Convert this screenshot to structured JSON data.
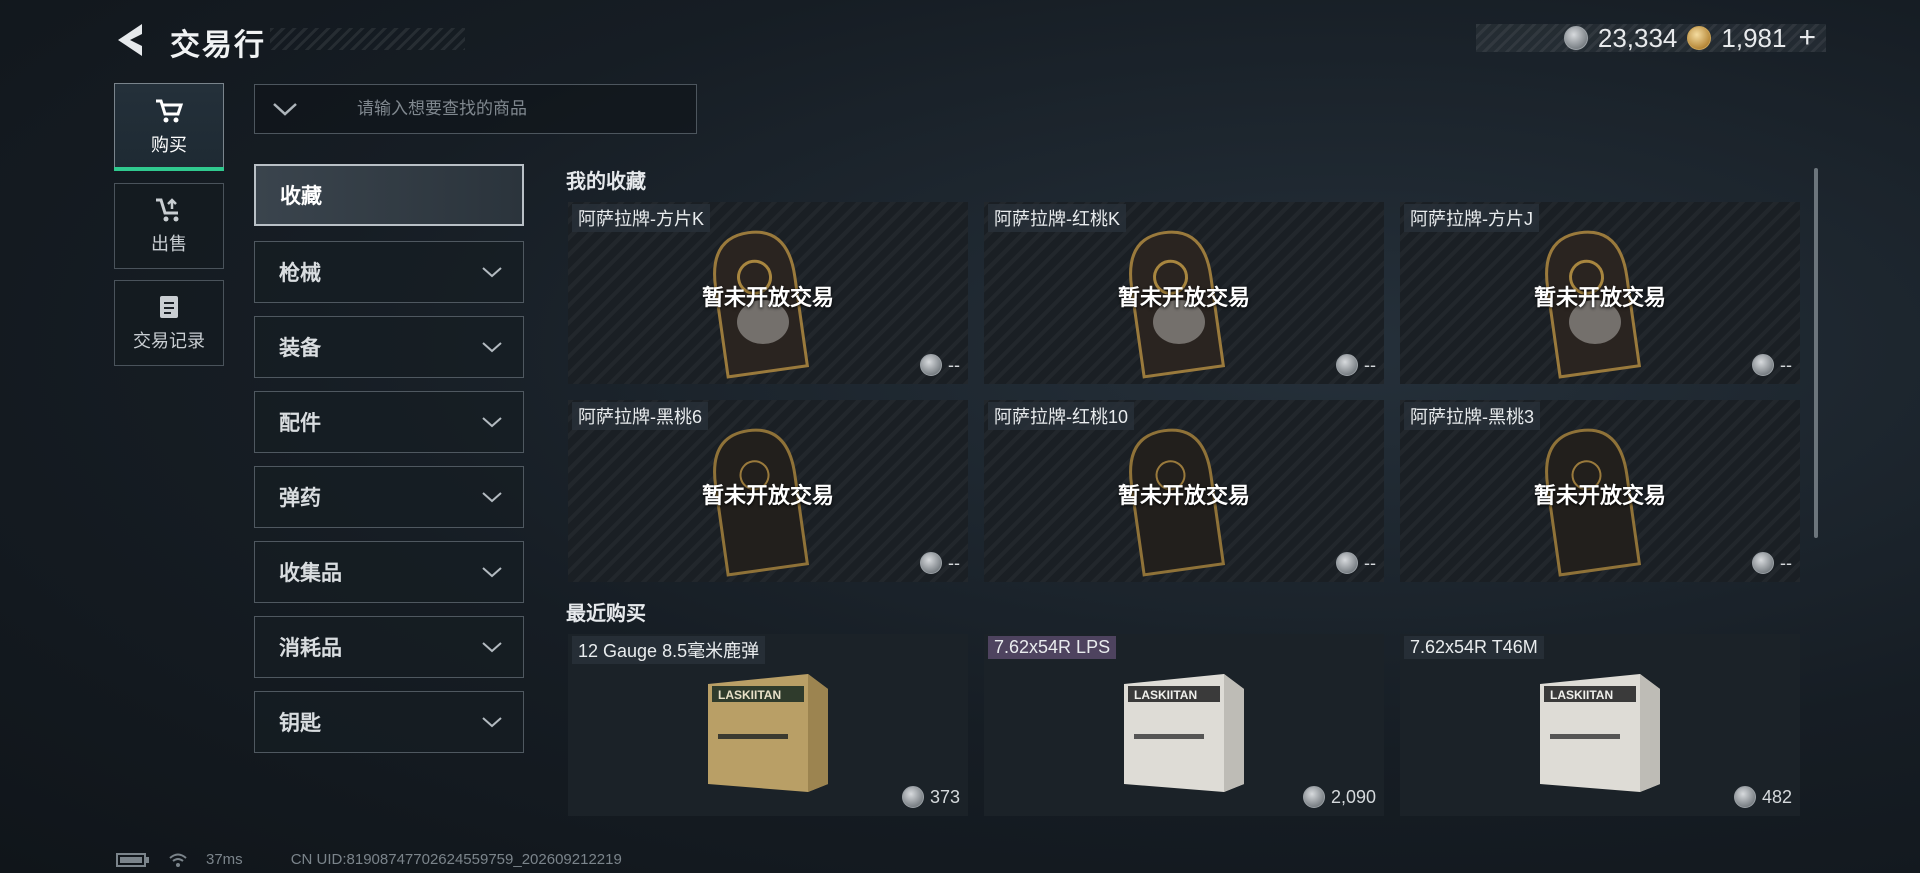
{
  "header": {
    "title": "交易行",
    "silver_amount": "23,334",
    "gold_amount": "1,981",
    "plus_label": "+"
  },
  "nav": [
    {
      "label": "购买",
      "icon": "cart-icon",
      "active": true
    },
    {
      "label": "出售",
      "icon": "sell-icon",
      "active": false
    },
    {
      "label": "交易记录",
      "icon": "record-icon",
      "active": false
    }
  ],
  "search": {
    "placeholder": "请输入想要查找的商品"
  },
  "categories": [
    {
      "label": "收藏",
      "active": true
    },
    {
      "label": "枪械"
    },
    {
      "label": "装备"
    },
    {
      "label": "配件"
    },
    {
      "label": "弹药"
    },
    {
      "label": "收集品"
    },
    {
      "label": "消耗品"
    },
    {
      "label": "钥匙"
    }
  ],
  "favorites": {
    "title": "我的收藏",
    "items": [
      {
        "name": "阿萨拉牌-方片K",
        "status": "暂未开放交易",
        "price": "--"
      },
      {
        "name": "阿萨拉牌-红桃K",
        "status": "暂未开放交易",
        "price": "--"
      },
      {
        "name": "阿萨拉牌-方片J",
        "status": "暂未开放交易",
        "price": "--"
      },
      {
        "name": "阿萨拉牌-黑桃6",
        "status": "暂未开放交易",
        "price": "--"
      },
      {
        "name": "阿萨拉牌-红桃10",
        "status": "暂未开放交易",
        "price": "--"
      },
      {
        "name": "阿萨拉牌-黑桃3",
        "status": "暂未开放交易",
        "price": "--"
      }
    ]
  },
  "recent": {
    "title": "最近购买",
    "items": [
      {
        "name": "12 Gauge 8.5毫米鹿弹",
        "price": "373",
        "box_color": "#c9b37a",
        "box_brand": "LASKIITAN"
      },
      {
        "name": "7.62x54R LPS",
        "price": "2,090",
        "box_color": "#e4e2dc",
        "box_brand": "LASKIITAN"
      },
      {
        "name": "7.62x54R T46M",
        "price": "482",
        "box_color": "#e4e2dc",
        "box_brand": "LASKIITAN"
      }
    ]
  },
  "footer": {
    "ping": "37ms",
    "uid": "CN UID:81908747702624559759_202609212219"
  }
}
